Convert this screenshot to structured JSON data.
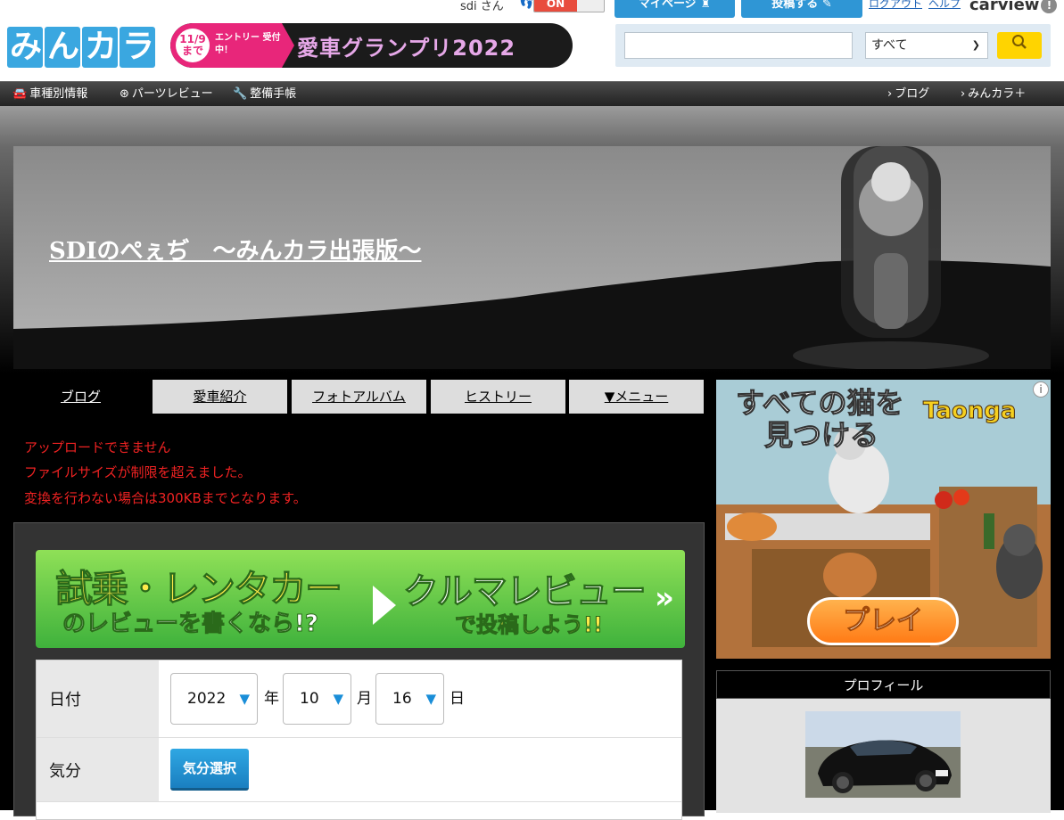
{
  "header": {
    "logo_text": [
      "み",
      "ん",
      "カ",
      "ラ"
    ],
    "user_label": "sdi さん",
    "toggle_label": "ON",
    "mypage_label": "マイページ",
    "post_label": "投稿する",
    "logout_label": "ログアウト",
    "help_label": "ヘルプ",
    "carview_label": "carview",
    "campaign": {
      "date": "11/9 まで",
      "entry": "エントリー 受付中！",
      "title": "愛車グランプリ2022"
    },
    "search": {
      "placeholder": "",
      "scope": "すべて"
    }
  },
  "navbar": {
    "items": [
      {
        "label": "車種別情報",
        "icon": "car-icon"
      },
      {
        "label": "パーツレビュー",
        "icon": "parts-icon"
      },
      {
        "label": "整備手帳",
        "icon": "wrench-icon"
      }
    ],
    "right": [
      "ブログ",
      "みんカラ＋"
    ]
  },
  "hero": {
    "title": "SDIのぺぇぢ　～みんカラ出張版～"
  },
  "tabs": [
    "ブログ",
    "愛車紹介",
    "フォトアルバム",
    "ヒストリー",
    "▼メニュー"
  ],
  "errors": [
    "アップロードできません",
    "ファイルサイズが制限を超えました。",
    "変換を行わない場合は300KBまでとなります。"
  ],
  "review_banner": {
    "left_line1": "試乗・レンタカー",
    "left_line2": "のレビューを書くなら!?",
    "right_line1": "クルマレビュー",
    "right_line2": "で投稿しよう!!"
  },
  "form": {
    "date_label": "日付",
    "year": "2022",
    "year_unit": "年",
    "month": "10",
    "month_unit": "月",
    "day": "16",
    "day_unit": "日",
    "mood_label": "気分",
    "mood_button": "気分選択"
  },
  "ad": {
    "headline_line1": "すべての猫を",
    "headline_line2": "見つける",
    "brand": "Taonga",
    "cta": "プレイ"
  },
  "profile": {
    "header": "プロフィール"
  }
}
